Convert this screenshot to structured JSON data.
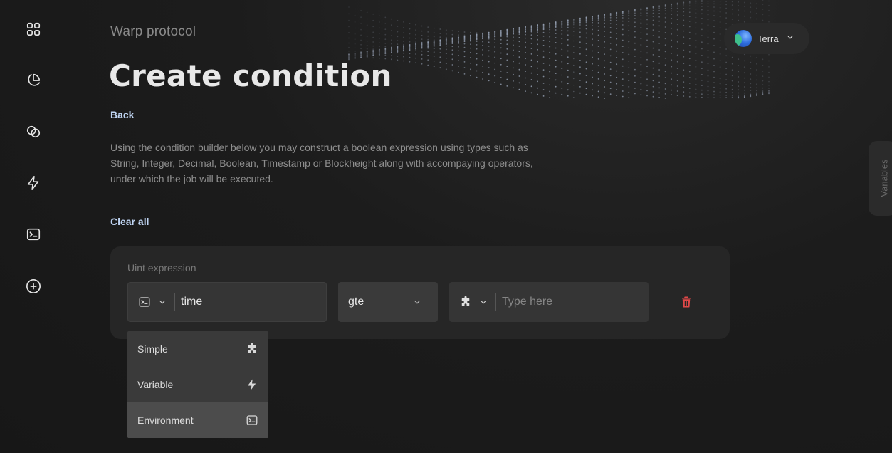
{
  "sidebar": {
    "items": [
      {
        "name": "dashboard",
        "icon": "grid-icon"
      },
      {
        "name": "analytics",
        "icon": "pie-chart-icon"
      },
      {
        "name": "jobs",
        "icon": "link-circles-icon"
      },
      {
        "name": "bolt",
        "icon": "lightning-icon"
      },
      {
        "name": "terminal",
        "icon": "terminal-icon"
      },
      {
        "name": "create",
        "icon": "plus-circle-icon"
      }
    ]
  },
  "header": {
    "brand": "Warp protocol",
    "title": "Create condition",
    "back_label": "Back"
  },
  "chain_selector": {
    "label": "Terra",
    "icon": "terra-logo-icon"
  },
  "description": "Using the condition builder below you may construct a boolean expression using types such as String, Integer, Decimal, Boolean, Timestamp or Blockheight along with accompaying operators, under which the job will be executed.",
  "clear_all_label": "Clear all",
  "variables_tab_label": "Variables",
  "expression": {
    "label": "Uint expression",
    "left": {
      "type_icon": "terminal-icon",
      "value": "time"
    },
    "operator": "gte",
    "right": {
      "type_icon": "puzzle-icon",
      "placeholder": "Type here"
    },
    "delete_icon": "trash-icon"
  },
  "type_menu": {
    "items": [
      {
        "label": "Simple",
        "icon": "puzzle-icon"
      },
      {
        "label": "Variable",
        "icon": "lightning-icon"
      },
      {
        "label": "Environment",
        "icon": "terminal-icon",
        "active": true
      }
    ]
  },
  "colors": {
    "background": "#1c1c1c",
    "card": "#262626",
    "link": "#bfd4f2",
    "danger": "#e04848"
  }
}
